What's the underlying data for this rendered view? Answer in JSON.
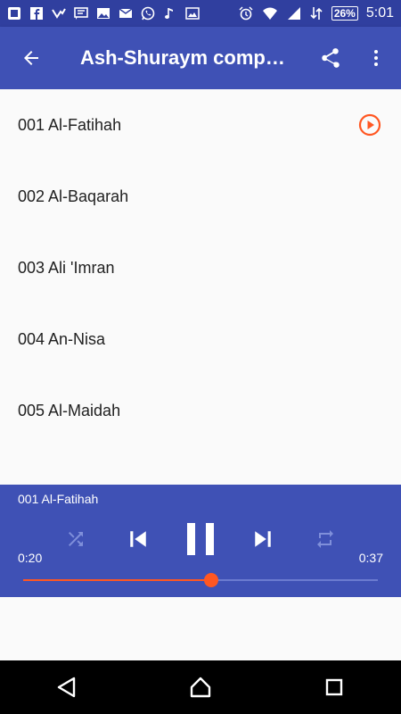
{
  "status_bar": {
    "battery": "26%",
    "time": "5:01"
  },
  "app_bar": {
    "title": "Ash-Shuraym comp…"
  },
  "surahs": [
    {
      "label": "001 Al-Fatihah"
    },
    {
      "label": "002 Al-Baqarah"
    },
    {
      "label": "003 Ali 'Imran"
    },
    {
      "label": "004  An-Nisa"
    },
    {
      "label": "005  Al-Maidah"
    }
  ],
  "player": {
    "now_playing": "001 Al-Fatihah",
    "current_time": "0:20",
    "total_time": "0:37",
    "progress": 0.53
  },
  "colors": {
    "primary": "#3f51b5",
    "primary_dark": "#303f9f",
    "accent": "#ff5722"
  }
}
